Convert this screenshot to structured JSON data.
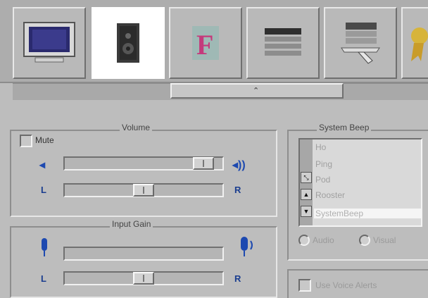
{
  "toolbar": {
    "tiles": [
      {
        "icon": "monitor-icon"
      },
      {
        "icon": "speaker-icon",
        "selected": true
      },
      {
        "icon": "font-icon"
      },
      {
        "icon": "menu-bars-icon"
      },
      {
        "icon": "network-icon"
      },
      {
        "icon": "ribbon-award-icon"
      }
    ],
    "scroll_arrow": "⌃"
  },
  "volume": {
    "title": "Volume",
    "mute_label": "Mute",
    "left_label": "L",
    "right_label": "R",
    "volume_level": 0.94,
    "balance_level": 0.5
  },
  "input_gain": {
    "title": "Input Gain",
    "left_label": "L",
    "right_label": "R",
    "gain_level": 0.0,
    "balance_level": 0.5
  },
  "system_beep": {
    "title": "System Beep",
    "items": [
      "Ho",
      "Ping",
      "Pod",
      "Rooster",
      "SystemBeep"
    ],
    "selected": "SystemBeep",
    "audio_label": "Audio",
    "visual_label": "Visual"
  },
  "voice_alerts": {
    "label": "Use Voice Alerts"
  }
}
